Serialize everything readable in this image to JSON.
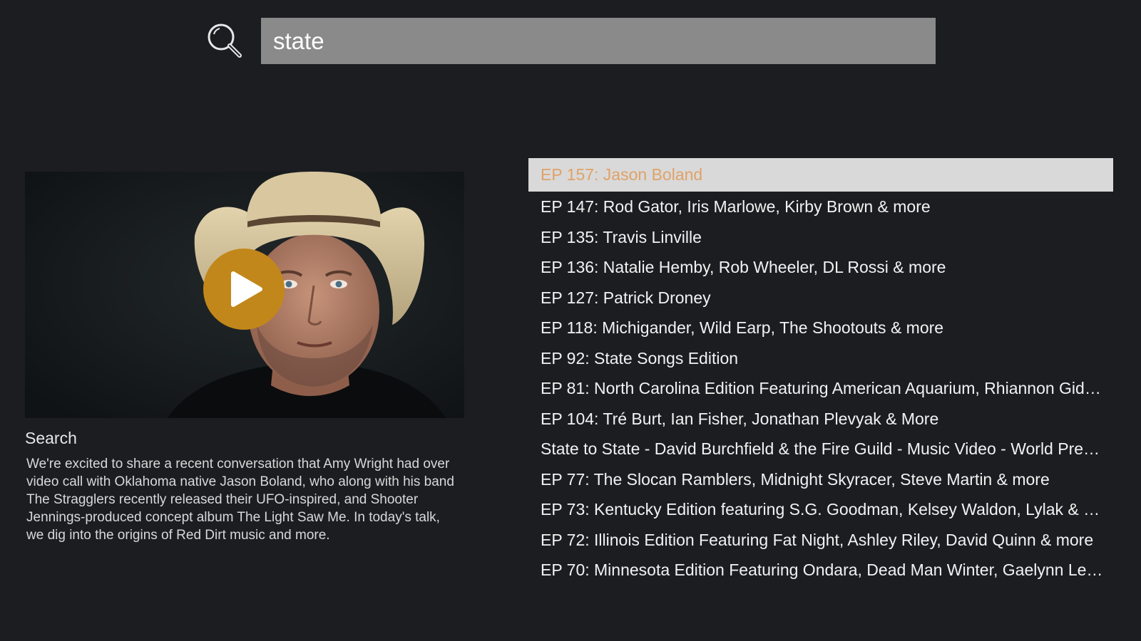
{
  "search": {
    "query": "state",
    "icon": "search-icon"
  },
  "preview": {
    "title": "Search",
    "description": "We're excited to share a recent conversation that Amy Wright had over video call with Oklahoma native Jason Boland, who along with his band The Stragglers recently released their UFO-inspired, and Shooter Jennings-produced concept album The Light Saw Me. In today's talk, we dig into the origins of Red Dirt music and more.",
    "play_icon": "play-icon",
    "accent_color": "#c2871a"
  },
  "results": {
    "selected_index": 0,
    "selected_text_color": "#e0a268",
    "items": [
      {
        "label": "EP 157: Jason Boland"
      },
      {
        "label": "EP 147: Rod Gator, Iris Marlowe, Kirby Brown & more"
      },
      {
        "label": "EP 135: Travis Linville"
      },
      {
        "label": "EP 136: Natalie Hemby, Rob Wheeler, DL Rossi & more"
      },
      {
        "label": "EP 127: Patrick Droney"
      },
      {
        "label": "EP 118: Michigander, Wild Earp, The Shootouts & more"
      },
      {
        "label": "EP 92: State Songs Edition"
      },
      {
        "label": "EP 81: North Carolina Edition Featuring American Aquarium, Rhiannon Giddens & more"
      },
      {
        "label": "EP 104: Tré Burt, Ian Fisher, Jonathan Plevyak & More"
      },
      {
        "label": "State to State - David Burchfield & the Fire Guild - Music Video - World Premiere"
      },
      {
        "label": "EP 77: The Slocan Ramblers, Midnight Skyracer, Steve Martin & more"
      },
      {
        "label": "EP 73: Kentucky Edition featuring S.G. Goodman, Kelsey Waldon, Lylak & more"
      },
      {
        "label": "EP 72: Illinois Edition Featuring Fat Night, Ashley Riley, David Quinn & more"
      },
      {
        "label": "EP 70: Minnesota Edition Featuring Ondara, Dead Man Winter, Gaelynn Lea & more"
      }
    ]
  }
}
